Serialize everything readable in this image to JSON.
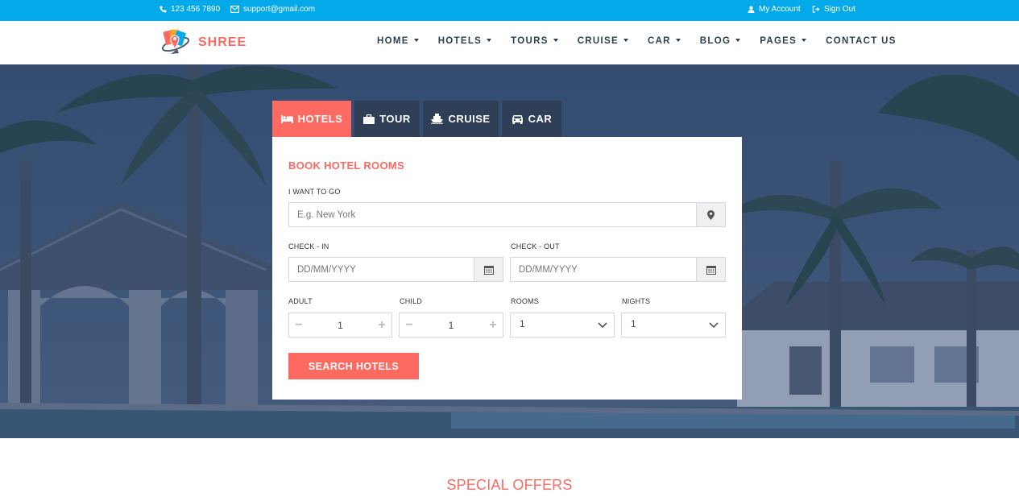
{
  "topbar": {
    "phone": "123 456 7890",
    "email": "support@gmail.com",
    "my_account": "My Account",
    "sign_out": "Sign Out"
  },
  "brand": {
    "name": "SHREE"
  },
  "nav": {
    "home": "HOME",
    "hotels": "HOTELS",
    "tours": "TOURS",
    "cruise": "CRUISE",
    "car": "CAR",
    "blog": "BLOG",
    "pages": "PAGES",
    "contact": "CONTACT US"
  },
  "tabs": {
    "hotels": "HOTELS",
    "tour": "TOUR",
    "cruise": "CRUISE",
    "car": "CAR"
  },
  "form": {
    "title": "BOOK HOTEL ROOMS",
    "destination_label": "I WANT TO GO",
    "destination_placeholder": "E.g. New York",
    "checkin_label": "CHECK - IN",
    "checkin_placeholder": "DD/MM/YYYY",
    "checkout_label": "CHECK - OUT",
    "checkout_placeholder": "DD/MM/YYYY",
    "adult_label": "ADULT",
    "adult_value": "1",
    "child_label": "CHILD",
    "child_value": "1",
    "rooms_label": "ROOMS",
    "rooms_value": "1",
    "nights_label": "NIGHTS",
    "nights_value": "1",
    "submit": "SEARCH HOTELS"
  },
  "section": {
    "special_offers": "SPECIAL OFFERS"
  },
  "colors": {
    "accent": "#fd6a62",
    "topbar": "#03a9e9",
    "dark": "#2e3f57"
  }
}
